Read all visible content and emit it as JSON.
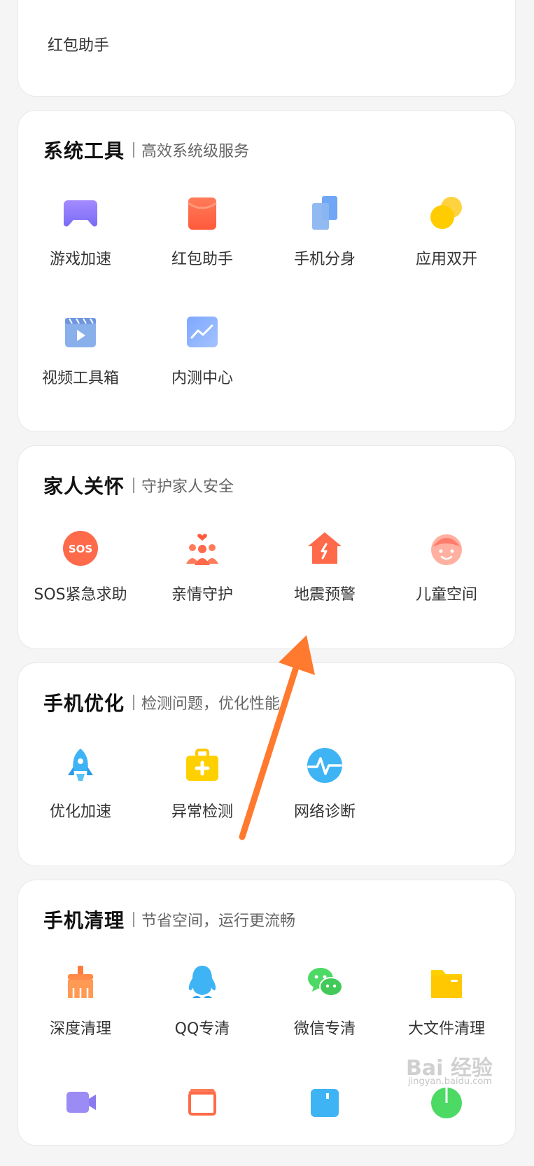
{
  "top_card": {
    "partial_item_label": "红包助手"
  },
  "sections": [
    {
      "title": "系统工具",
      "subtitle": "高效系统级服务",
      "items": [
        {
          "label": "游戏加速",
          "icon": "gamepad-icon"
        },
        {
          "label": "红包助手",
          "icon": "red-envelope-icon"
        },
        {
          "label": "手机分身",
          "icon": "phone-clone-icon"
        },
        {
          "label": "应用双开",
          "icon": "dual-app-icon"
        },
        {
          "label": "视频工具箱",
          "icon": "video-toolbox-icon"
        },
        {
          "label": "内测中心",
          "icon": "beta-center-icon"
        }
      ]
    },
    {
      "title": "家人关怀",
      "subtitle": "守护家人安全",
      "items": [
        {
          "label": "SOS紧急求助",
          "icon": "sos-icon",
          "icon_text": "SOS"
        },
        {
          "label": "亲情守护",
          "icon": "family-guard-icon"
        },
        {
          "label": "地震预警",
          "icon": "earthquake-warning-icon"
        },
        {
          "label": "儿童空间",
          "icon": "kids-space-icon"
        }
      ]
    },
    {
      "title": "手机优化",
      "subtitle": "检测问题，优化性能",
      "items": [
        {
          "label": "优化加速",
          "icon": "rocket-icon"
        },
        {
          "label": "异常检测",
          "icon": "first-aid-kit-icon"
        },
        {
          "label": "网络诊断",
          "icon": "network-pulse-icon"
        }
      ]
    },
    {
      "title": "手机清理",
      "subtitle": "节省空间，运行更流畅",
      "items": [
        {
          "label": "深度清理",
          "icon": "broom-icon"
        },
        {
          "label": "QQ专清",
          "icon": "qq-penguin-icon"
        },
        {
          "label": "微信专清",
          "icon": "wechat-icon"
        },
        {
          "label": "大文件清理",
          "icon": "folder-icon"
        }
      ]
    }
  ],
  "watermark": {
    "main": "Bai 经验",
    "sub": "jingyan.baidu.com"
  },
  "colors": {
    "arrow": "#ff7a2e",
    "background": "#f5f5f5",
    "card": "#ffffff"
  }
}
